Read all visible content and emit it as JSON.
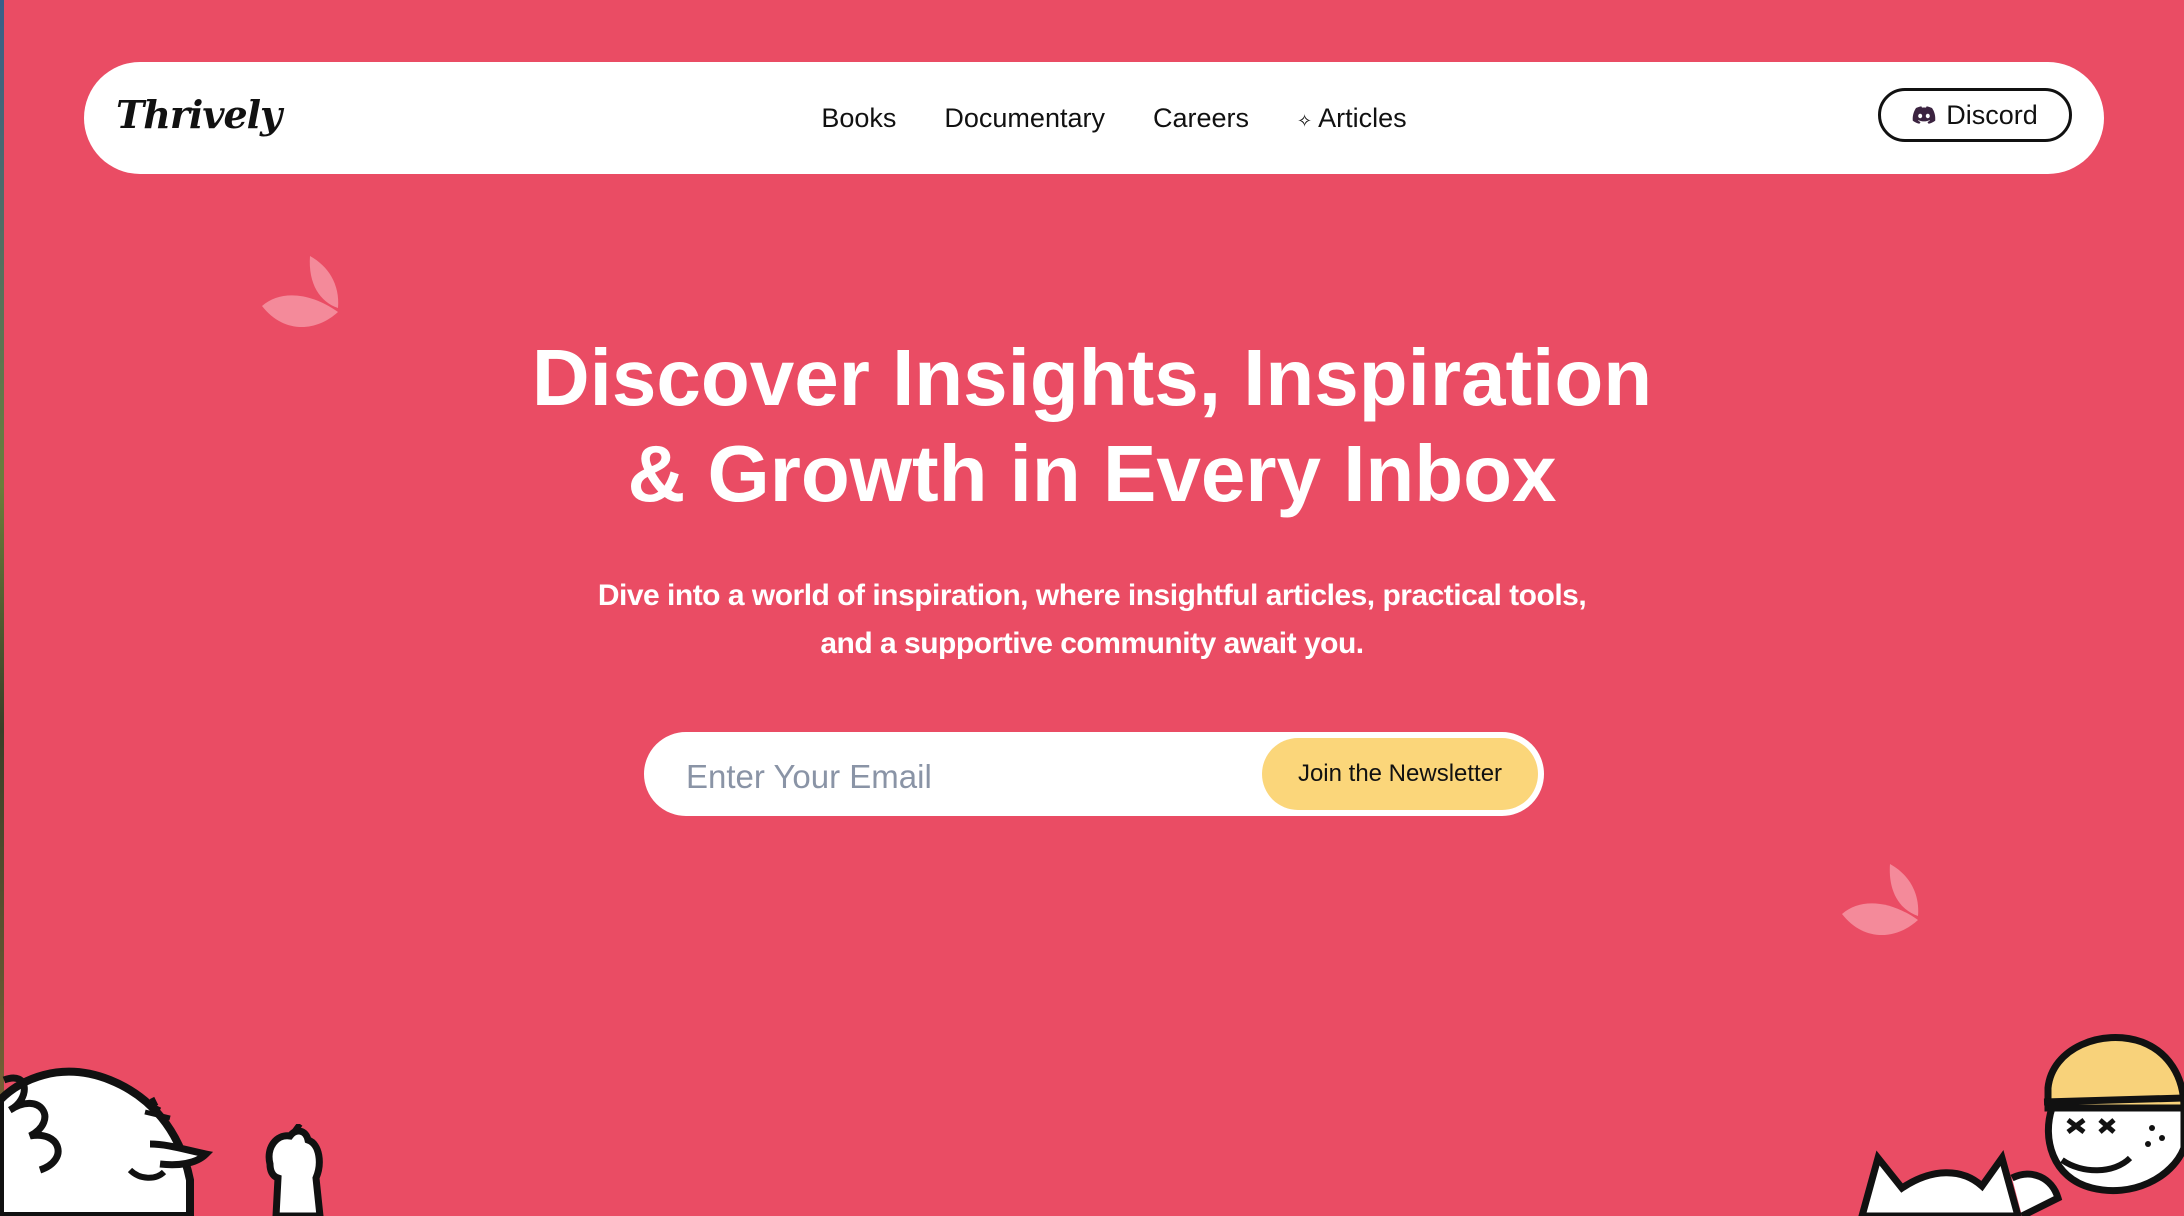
{
  "brand": {
    "logo_text": "Thrively"
  },
  "nav": {
    "links": [
      {
        "label": "Books"
      },
      {
        "label": "Documentary"
      },
      {
        "label": "Careers"
      },
      {
        "label": "Articles",
        "icon": "sparkle-icon"
      }
    ],
    "discord_label": "Discord"
  },
  "hero": {
    "title_line1": "Discover Insights, Inspiration",
    "title_line2": "& Growth in Every Inbox",
    "subtitle_line1": "Dive into a world of inspiration, where insightful articles, practical tools,",
    "subtitle_line2": "and a supportive community await you."
  },
  "newsletter": {
    "email_placeholder": "Enter Your Email",
    "email_value": "",
    "join_label": "Join the Newsletter"
  },
  "colors": {
    "background": "#ea4c64",
    "navbar": "#ffffff",
    "button_accent": "#fbd67a",
    "leaf": "#f48a9a"
  }
}
